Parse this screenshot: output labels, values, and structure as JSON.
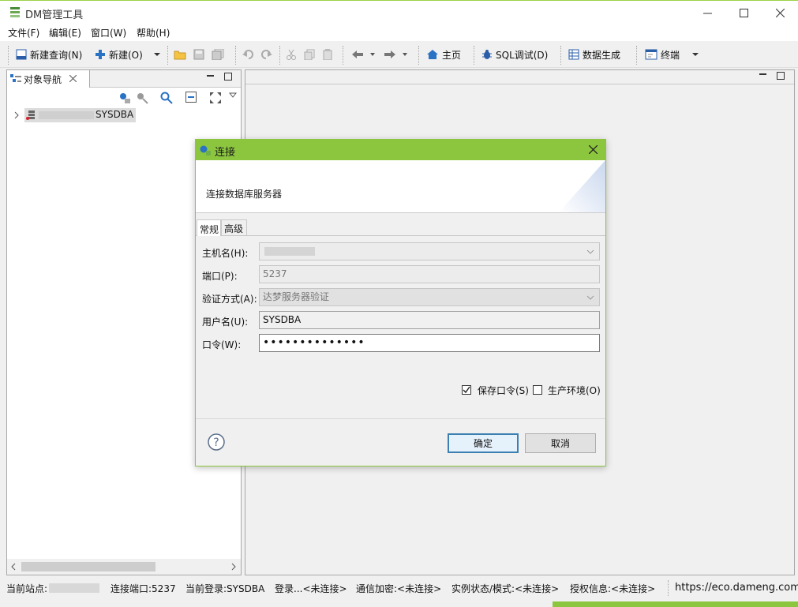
{
  "window": {
    "title": "DM管理工具"
  },
  "menu": [
    "文件(F)",
    "编辑(E)",
    "窗口(W)",
    "帮助(H)"
  ],
  "toolbar": {
    "new_query": "新建查询(N)",
    "new": "新建(O)",
    "home": "主页",
    "sql_debug": "SQL调试(D)",
    "data_gen": "数据生成",
    "terminal": "终端"
  },
  "navigator": {
    "tab_label": "对象导航",
    "tree_item": "SYSDBA"
  },
  "dialog": {
    "title": "连接",
    "header": "连接数据库服务器",
    "tabs": [
      "常规",
      "高级"
    ],
    "fields": {
      "host_label": "主机名(H):",
      "port_label": "端口(P):",
      "port_value": "5237",
      "auth_label": "验证方式(A):",
      "auth_value": "达梦服务器验证",
      "user_label": "用户名(U):",
      "user_value": "SYSDBA",
      "password_label": "口令(W):",
      "password_value": "••••••••••••••"
    },
    "save_password": "保存口令(S)",
    "production_env": "生产环境(O)",
    "ok": "确定",
    "cancel": "取消"
  },
  "status": {
    "site": "当前站点:",
    "port": "连接端口:5237",
    "login": "当前登录:SYSDBA",
    "logon": "登录...<未连接>",
    "encryption": "通信加密:<未连接>",
    "instance": "实例状态/模式:<未连接>",
    "license": "授权信息:<未连接>",
    "url": "https://eco.dameng.com"
  },
  "colors": {
    "accent": "#8cc63f",
    "primary_border": "#3c7fb1"
  }
}
